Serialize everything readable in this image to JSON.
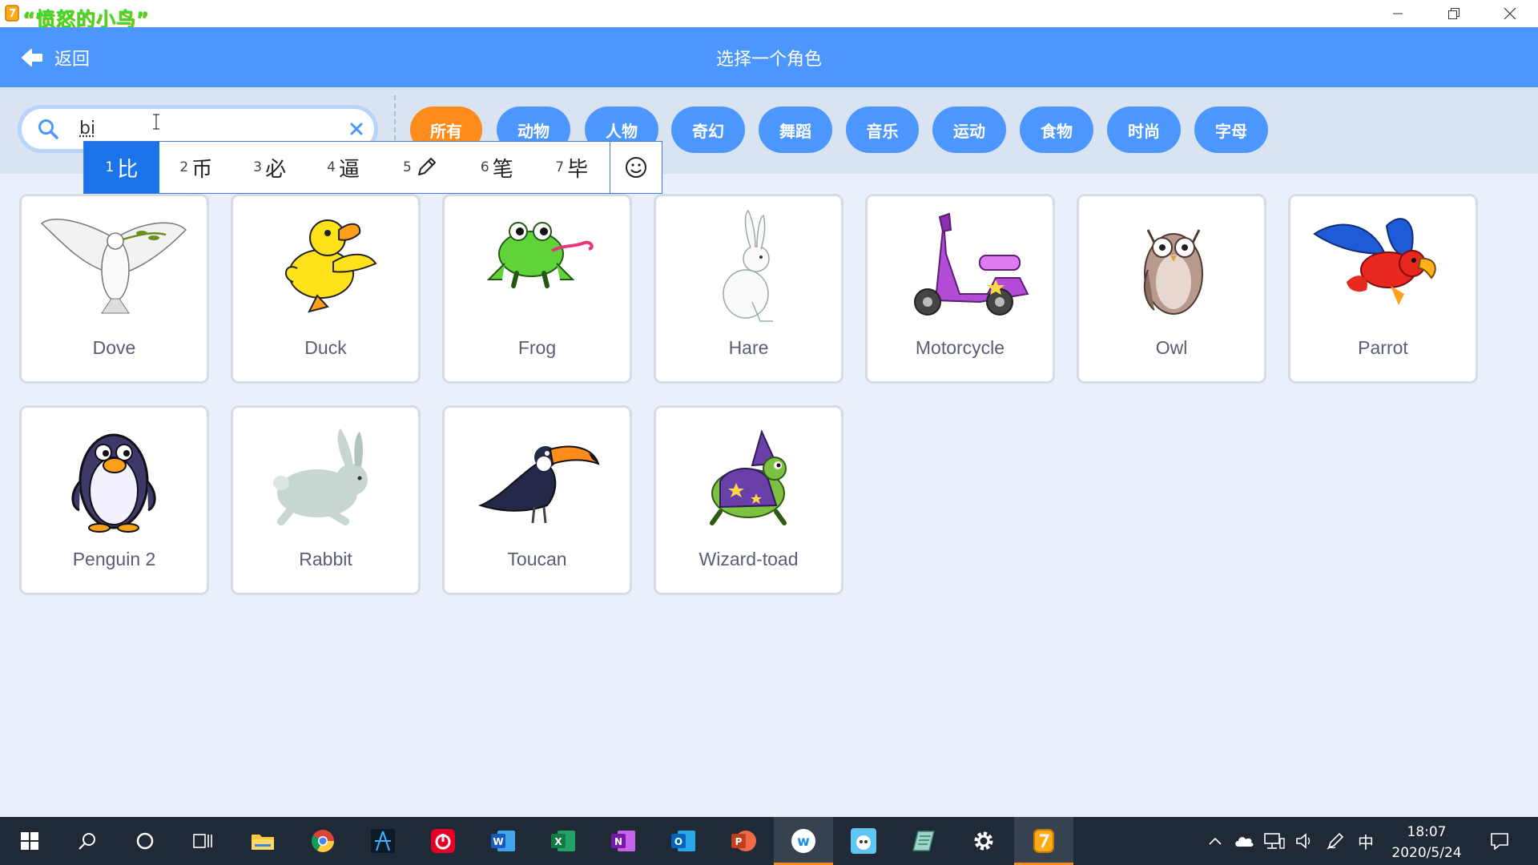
{
  "window": {
    "title": "“愤怒的小鸟”"
  },
  "header": {
    "back_label": "返回",
    "title": "选择一个角色"
  },
  "search": {
    "value": "bi"
  },
  "tags": [
    {
      "label": "所有",
      "active": true
    },
    {
      "label": "动物"
    },
    {
      "label": "人物"
    },
    {
      "label": "奇幻"
    },
    {
      "label": "舞蹈"
    },
    {
      "label": "音乐"
    },
    {
      "label": "运动"
    },
    {
      "label": "食物"
    },
    {
      "label": "时尚"
    },
    {
      "label": "字母"
    }
  ],
  "ime": {
    "candidates": [
      {
        "num": "1",
        "text": "比",
        "selected": true
      },
      {
        "num": "2",
        "text": "币"
      },
      {
        "num": "3",
        "text": "必"
      },
      {
        "num": "4",
        "text": "逼"
      },
      {
        "num": "5",
        "text": "",
        "icon": "pencil-icon"
      },
      {
        "num": "6",
        "text": "笔"
      },
      {
        "num": "7",
        "text": "毕"
      }
    ]
  },
  "sprites": [
    {
      "name": "Dove",
      "icon": "dove-icon"
    },
    {
      "name": "Duck",
      "icon": "duck-icon"
    },
    {
      "name": "Frog",
      "icon": "frog-icon"
    },
    {
      "name": "Hare",
      "icon": "hare-icon"
    },
    {
      "name": "Motorcycle",
      "icon": "motorcycle-icon"
    },
    {
      "name": "Owl",
      "icon": "owl-icon"
    },
    {
      "name": "Parrot",
      "icon": "parrot-icon"
    },
    {
      "name": "Penguin 2",
      "icon": "penguin-icon"
    },
    {
      "name": "Rabbit",
      "icon": "rabbit-icon"
    },
    {
      "name": "Toucan",
      "icon": "toucan-icon"
    },
    {
      "name": "Wizard-toad",
      "icon": "wizard-toad-icon"
    }
  ],
  "taskbar": {
    "ime_indicator": "中",
    "time": "18:07",
    "date": "2020/5/24"
  },
  "colors": {
    "header": "#4c97ff",
    "active_tag": "#ff8c1a",
    "card_text": "#575e75"
  }
}
